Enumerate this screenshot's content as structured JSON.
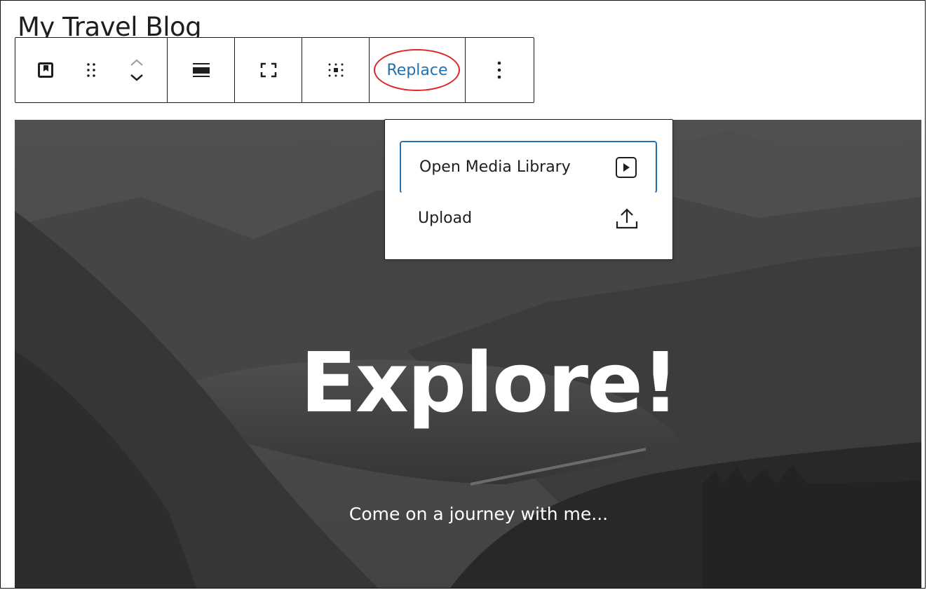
{
  "page": {
    "title": "My Travel Blog"
  },
  "toolbar": {
    "block_icon": "cover-block-icon",
    "drag_handle_icon": "drag-handle-icon",
    "move_up_icon": "chevron-up-icon",
    "move_down_icon": "chevron-down-icon",
    "align_icon": "align-wide-icon",
    "fullheight_icon": "full-height-icon",
    "position_icon": "content-position-icon",
    "replace_label": "Replace",
    "replace_highlight_color": "#e0242b",
    "more_icon": "more-vertical-icon"
  },
  "replace_menu": {
    "items": [
      {
        "label": "Open Media Library",
        "icon": "media-play-icon",
        "focused": true
      },
      {
        "label": "Upload",
        "icon": "upload-icon",
        "focused": false
      }
    ]
  },
  "cover": {
    "heading": "Explore!",
    "subtitle": "Come on a journey with me..."
  },
  "colors": {
    "accent": "#2271b1",
    "text": "#1e1e1e",
    "cover_text": "#ffffff"
  }
}
